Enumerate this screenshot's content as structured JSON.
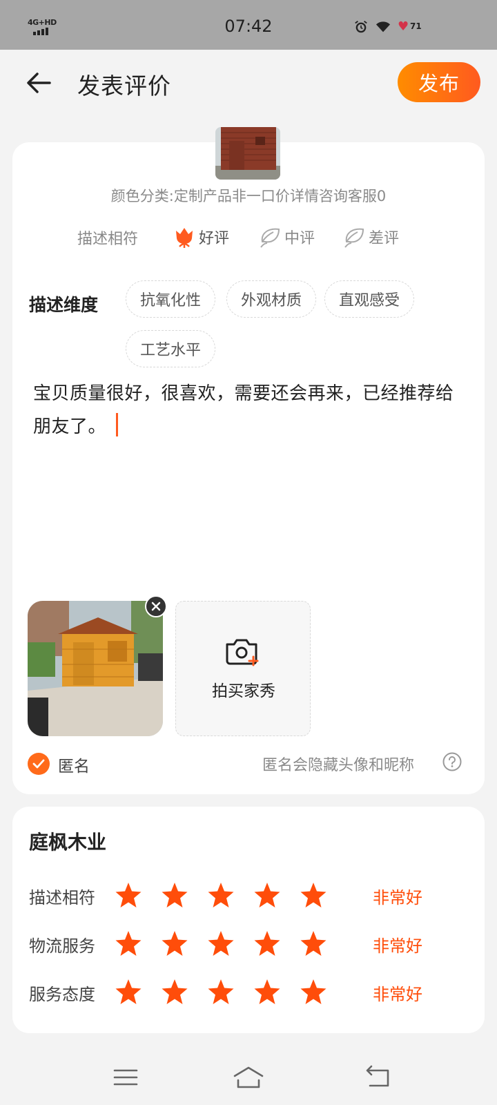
{
  "status_bar": {
    "network": "4G+HD",
    "time": "07:42",
    "battery": "71"
  },
  "header": {
    "title": "发表评价",
    "publish_label": "发布"
  },
  "product": {
    "variant": "颜色分类:定制产品非一口价详情咨询客服0"
  },
  "rating": {
    "label": "描述相符",
    "options": [
      {
        "label": "好评",
        "selected": true
      },
      {
        "label": "中评",
        "selected": false
      },
      {
        "label": "差评",
        "selected": false
      }
    ]
  },
  "dimensions": {
    "label": "描述维度",
    "tags": [
      "抗氧化性",
      "外观材质",
      "直观感受",
      "工艺水平"
    ]
  },
  "review": {
    "text": "宝贝质量很好，很喜欢，需要还会再来，已经推荐给朋友了。"
  },
  "photos": {
    "add_label": "拍买家秀"
  },
  "anonymous": {
    "label": "匿名",
    "checked": true,
    "hint": "匿名会隐藏头像和昵称"
  },
  "shop": {
    "name": "庭枫木业",
    "scores": [
      {
        "label": "描述相符",
        "stars": 5,
        "text": "非常好"
      },
      {
        "label": "物流服务",
        "stars": 5,
        "text": "非常好"
      },
      {
        "label": "服务态度",
        "stars": 5,
        "text": "非常好"
      }
    ]
  },
  "colors": {
    "accent": "#ff5a1f",
    "accent_gradient_start": "#ff8c00",
    "star": "#ff4d0a"
  }
}
